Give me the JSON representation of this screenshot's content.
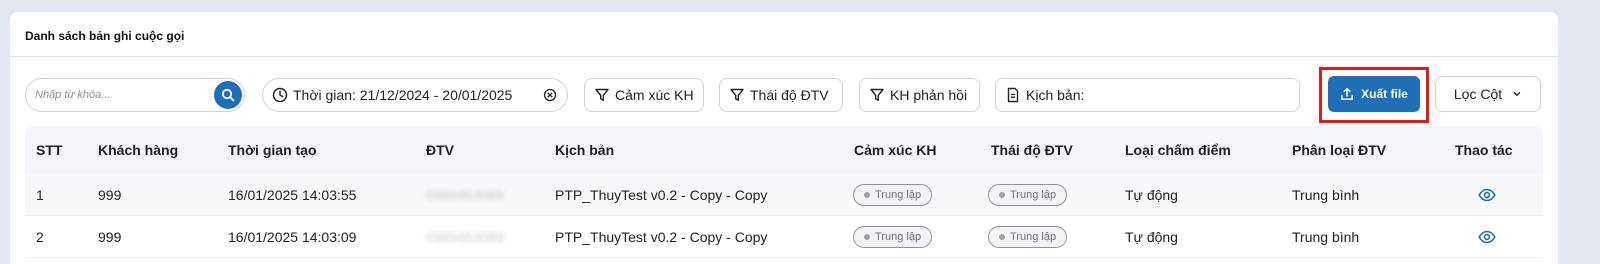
{
  "card": {
    "title": "Danh sách bản ghi cuộc gọi"
  },
  "toolbar": {
    "search_placeholder": "Nhập từ khóa...",
    "date_label": "Thời gian: 21/12/2024 - 20/01/2025",
    "filter_emotion": "Cảm xúc KH",
    "filter_attitude": "Thái độ ĐTV",
    "filter_feedback": "KH phản hồi",
    "script_label": "Kịch bản:",
    "export_label": "Xuất file",
    "columns_label": "Lọc Cột"
  },
  "colors": {
    "primary": "#1e6fb8",
    "highlight": "#e01b1b"
  },
  "table": {
    "headers": {
      "stt": "STT",
      "customer": "Khách hàng",
      "created_time": "Thời gian tạo",
      "agent": "ĐTV",
      "script": "Kịch bản",
      "emotion": "Cảm xúc KH",
      "attitude": "Thái độ ĐTV",
      "scoring_type": "Loại chấm điểm",
      "agent_class": "Phân loại ĐTV",
      "actions": "Thao tác"
    },
    "rows": [
      {
        "stt": "1",
        "customer": "999",
        "created_time": "16/01/2025 14:03:55",
        "agent": "0989453089",
        "script": "PTP_ThuyTest v0.2 - Copy - Copy",
        "emotion": "Trung lập",
        "attitude": "Trung lập",
        "scoring_type": "Tự động",
        "agent_class": "Trung bình",
        "action_icon": "eye-icon"
      },
      {
        "stt": "2",
        "customer": "999",
        "created_time": "16/01/2025 14:03:09",
        "agent": "0989453089",
        "script": "PTP_ThuyTest v0.2 - Copy - Copy",
        "emotion": "Trung lập",
        "attitude": "Trung lập",
        "scoring_type": "Tự động",
        "agent_class": "Trung bình",
        "action_icon": "eye-icon"
      }
    ]
  }
}
